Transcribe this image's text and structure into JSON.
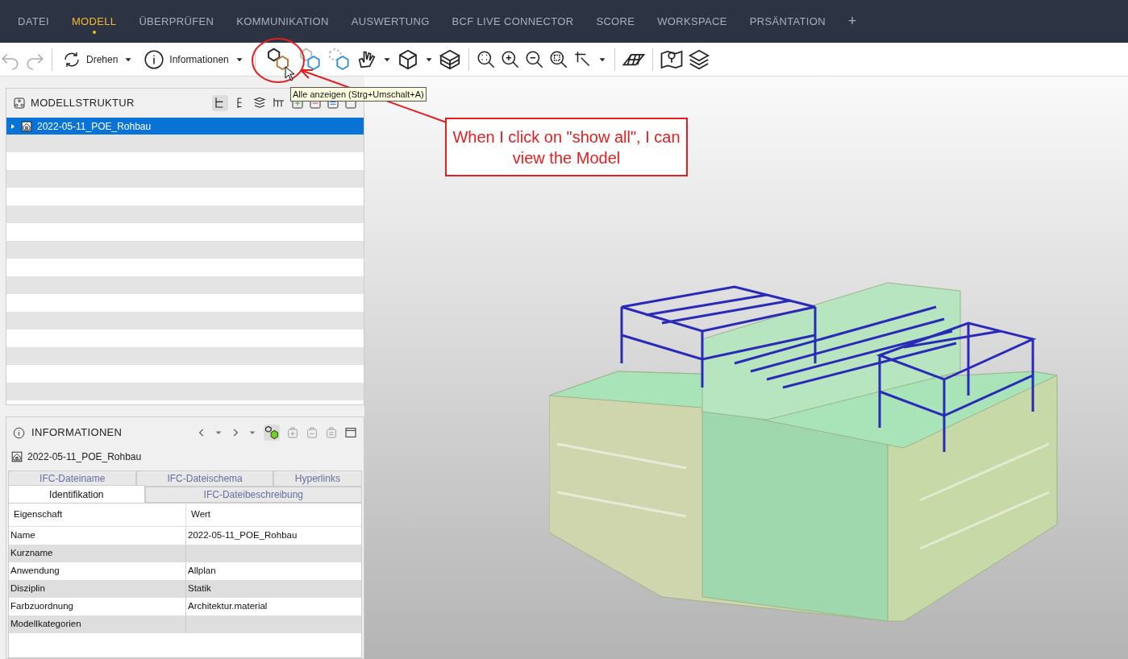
{
  "menu_tabs": [
    {
      "label": "DATEI",
      "selected": false
    },
    {
      "label": "MODELL",
      "selected": true
    },
    {
      "label": "ÜBERPRÜFEN",
      "selected": false
    },
    {
      "label": "KOMMUNIKATION",
      "selected": false
    },
    {
      "label": "AUSWERTUNG",
      "selected": false
    },
    {
      "label": "BCF LIVE CONNECTOR",
      "selected": false
    },
    {
      "label": "SCORE",
      "selected": false
    },
    {
      "label": "WORKSPACE",
      "selected": false
    },
    {
      "label": "PRSÄNTATION",
      "selected": false
    }
  ],
  "add_tab": "+",
  "toolbar": {
    "rotate_label": "Drehen",
    "info_label": "Informationen",
    "tooltip": "Alle anzeigen (Strg+Umschalt+A)"
  },
  "model_structure": {
    "title": "MODELLSTRUKTUR",
    "items": [
      {
        "label": "2022-05-11_POE_Rohbau",
        "selected": true,
        "expanded": false
      }
    ]
  },
  "information": {
    "title": "INFORMATIONEN",
    "object": "2022-05-11_POE_Rohbau",
    "tabs_back": [
      {
        "label": "IFC-Dateiname",
        "selected": false
      },
      {
        "label": "IFC-Dateischema",
        "selected": false
      },
      {
        "label": "Hyperlinks",
        "selected": false
      }
    ],
    "tabs_front": [
      {
        "label": "Identifikation",
        "selected": true
      },
      {
        "label": "IFC-Dateibeschreibung",
        "selected": false
      }
    ],
    "columns": [
      "Eigenschaft",
      "Wert"
    ],
    "rows": [
      [
        "Name",
        "2022-05-11_POE_Rohbau"
      ],
      [
        "Kurzname",
        ""
      ],
      [
        "Anwendung",
        "Allplan"
      ],
      [
        "Disziplin",
        "Statik"
      ],
      [
        "Farbzuordnung",
        "Architektur.material"
      ],
      [
        "Modellkategorien",
        ""
      ]
    ]
  },
  "annotation": {
    "text": "When I click on \"show all\", I can view the Model"
  }
}
